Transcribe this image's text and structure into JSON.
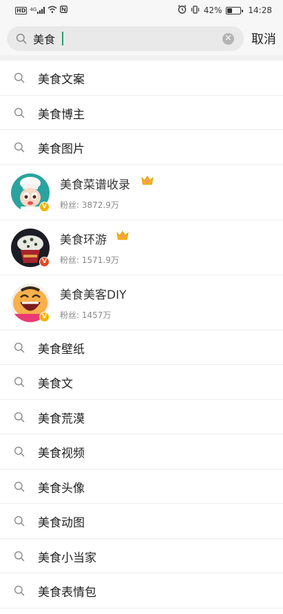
{
  "status_bar": {
    "hd": "HD",
    "net": "4G",
    "battery_text": "42%",
    "battery_level": 0.42,
    "time": "14:28"
  },
  "search": {
    "query": "美食",
    "cancel_label": "取消"
  },
  "suggestions_top": [
    {
      "text": "美食文案"
    },
    {
      "text": "美食博主"
    },
    {
      "text": "美食图片"
    }
  ],
  "users": [
    {
      "name": "美食菜谱收录",
      "fans": "粉丝: 3872.9万",
      "badge": "V",
      "badge_color": "#f3b200"
    },
    {
      "name": "美食环游",
      "fans": "粉丝: 1571.9万",
      "badge": "V",
      "badge_color": "#e14b1f"
    },
    {
      "name": "美食美客DIY",
      "fans": "粉丝: 1457万",
      "badge": "V",
      "badge_color": "#f3b200"
    }
  ],
  "suggestions_bottom": [
    {
      "text": "美食壁纸"
    },
    {
      "text": "美食文"
    },
    {
      "text": "美食荒漠"
    },
    {
      "text": "美食视频"
    },
    {
      "text": "美食头像"
    },
    {
      "text": "美食动图"
    },
    {
      "text": "美食小当家"
    },
    {
      "text": "美食表情包"
    }
  ],
  "colors": {
    "caret": "#2a9b6e",
    "crown": "#f5b400"
  }
}
